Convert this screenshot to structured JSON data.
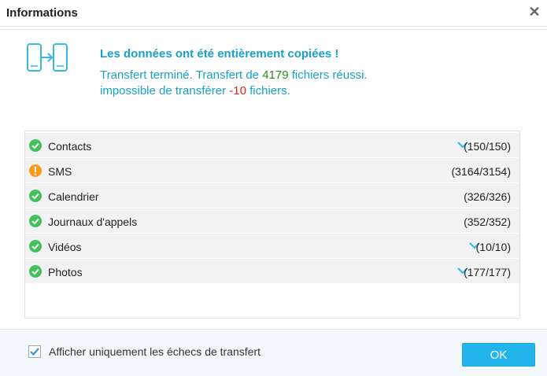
{
  "window": {
    "title": "Informations",
    "close_symbol": "✕"
  },
  "summary": {
    "headline": "Les données ont été entièrement copiées !",
    "line1_prefix": "Transfert terminé. Transfert de ",
    "line1_count": "4179",
    "line1_suffix": " fichiers réussi.",
    "line2_prefix": "impossible de transférer ",
    "line2_count": "-10",
    "line2_suffix": " fichiers."
  },
  "icons": {
    "transfer": "phone-transfer-icon",
    "success": "check-circle-icon",
    "warning": "warning-circle-icon",
    "expand": "chevron-down-icon"
  },
  "colors": {
    "accent": "#1aa1c9",
    "success_count": "#2e8a16",
    "fail_count": "#e32222",
    "success_icon": "#43c05d",
    "warning_icon": "#ff9a1a",
    "button": "#24b4ec"
  },
  "items": [
    {
      "label": "Contacts",
      "count": "(150/150)",
      "status": "success",
      "expandable": true
    },
    {
      "label": "SMS",
      "count": "(3164/3154)",
      "status": "warning",
      "expandable": false
    },
    {
      "label": "Calendrier",
      "count": "(326/326)",
      "status": "success",
      "expandable": false
    },
    {
      "label": "Journaux d'appels",
      "count": "(352/352)",
      "status": "success",
      "expandable": false
    },
    {
      "label": "Vidéos",
      "count": "(10/10)",
      "status": "success",
      "expandable": true
    },
    {
      "label": "Photos",
      "count": "(177/177)",
      "status": "success",
      "expandable": true
    }
  ],
  "footer": {
    "checkbox_checked": true,
    "checkbox_label": "Afficher uniquement les échecs de transfert",
    "ok_label": "OK"
  }
}
